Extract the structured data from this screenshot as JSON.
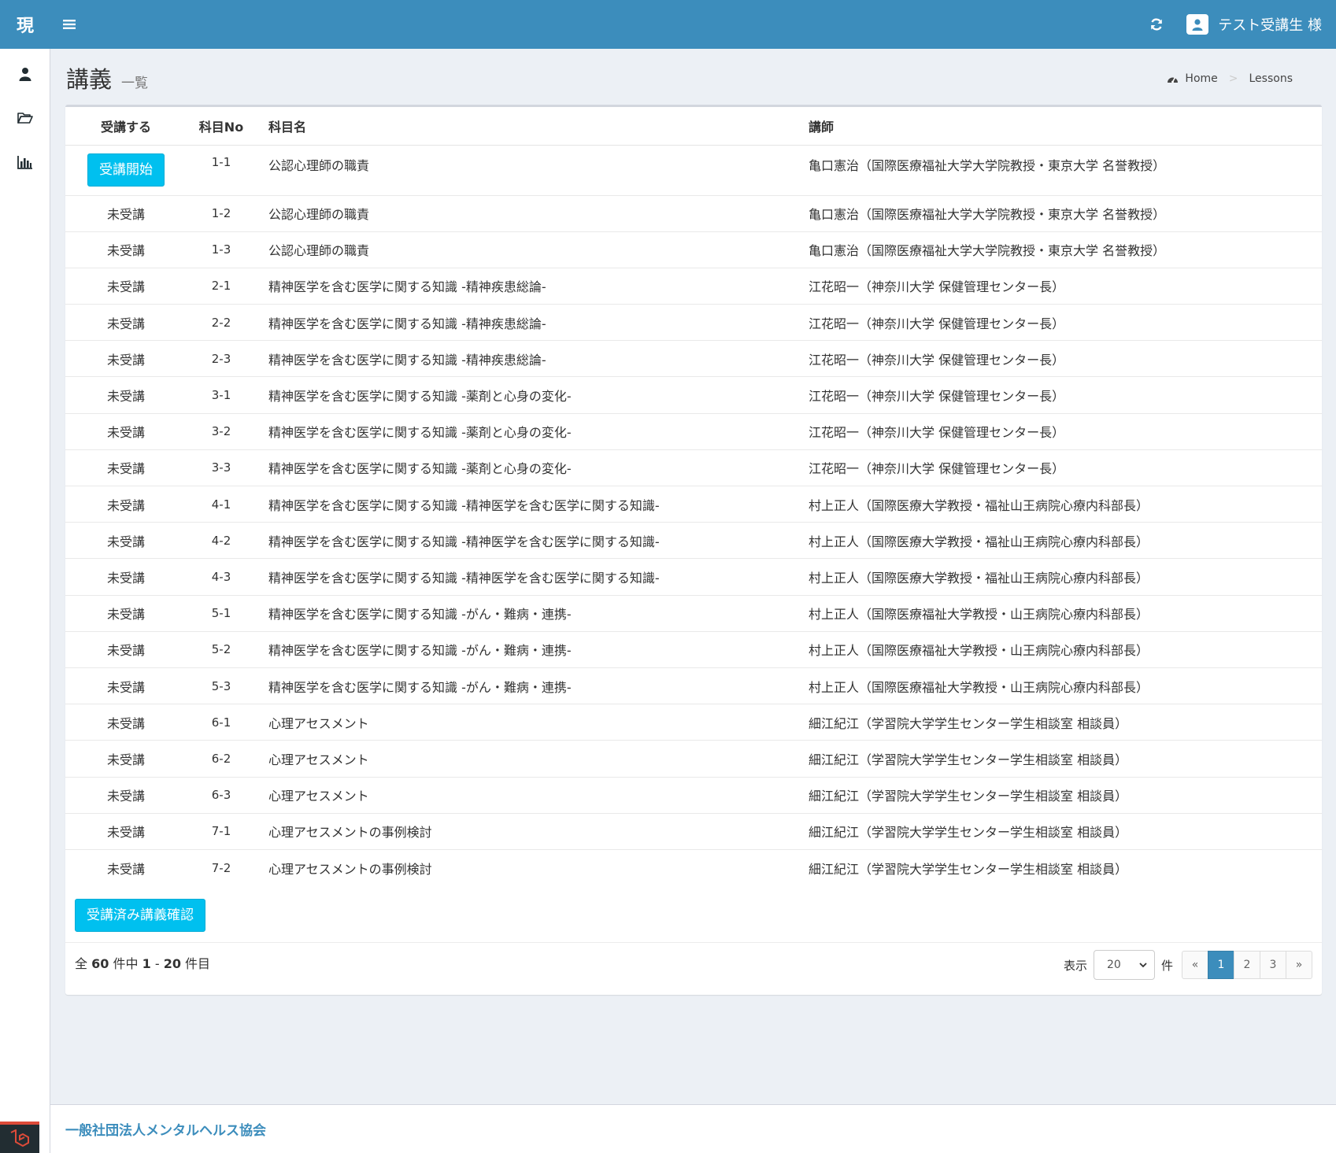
{
  "header": {
    "logo": "現",
    "user_name": "テスト受講生 様"
  },
  "content_header": {
    "title": "講義",
    "subtitle": "一覧",
    "breadcrumb": {
      "home": "Home",
      "current": "Lessons"
    }
  },
  "table": {
    "columns": [
      "受講する",
      "科目No",
      "科目名",
      "講師"
    ],
    "rows": [
      {
        "status": "受講開始",
        "no": "1-1",
        "name": "公認心理師の職責",
        "teacher": "亀口憲治（国際医療福祉大学大学院教授・東京大学 名誉教授）"
      },
      {
        "status": "未受講",
        "no": "1-2",
        "name": "公認心理師の職責",
        "teacher": "亀口憲治（国際医療福祉大学大学院教授・東京大学 名誉教授）"
      },
      {
        "status": "未受講",
        "no": "1-3",
        "name": "公認心理師の職責",
        "teacher": "亀口憲治（国際医療福祉大学大学院教授・東京大学 名誉教授）"
      },
      {
        "status": "未受講",
        "no": "2-1",
        "name": "精神医学を含む医学に関する知識 -精神疾患総論-",
        "teacher": "江花昭一（神奈川大学 保健管理センター長）"
      },
      {
        "status": "未受講",
        "no": "2-2",
        "name": "精神医学を含む医学に関する知識 -精神疾患総論-",
        "teacher": "江花昭一（神奈川大学 保健管理センター長）"
      },
      {
        "status": "未受講",
        "no": "2-3",
        "name": "精神医学を含む医学に関する知識 -精神疾患総論-",
        "teacher": "江花昭一（神奈川大学 保健管理センター長）"
      },
      {
        "status": "未受講",
        "no": "3-1",
        "name": "精神医学を含む医学に関する知識 -薬剤と心身の変化-",
        "teacher": "江花昭一（神奈川大学 保健管理センター長）"
      },
      {
        "status": "未受講",
        "no": "3-2",
        "name": "精神医学を含む医学に関する知識 -薬剤と心身の変化-",
        "teacher": "江花昭一（神奈川大学 保健管理センター長）"
      },
      {
        "status": "未受講",
        "no": "3-3",
        "name": "精神医学を含む医学に関する知識 -薬剤と心身の変化-",
        "teacher": "江花昭一（神奈川大学 保健管理センター長）"
      },
      {
        "status": "未受講",
        "no": "4-1",
        "name": "精神医学を含む医学に関する知識 -精神医学を含む医学に関する知識-",
        "teacher": "村上正人（国際医療大学教授・福祉山王病院心療内科部長）"
      },
      {
        "status": "未受講",
        "no": "4-2",
        "name": "精神医学を含む医学に関する知識 -精神医学を含む医学に関する知識-",
        "teacher": "村上正人（国際医療大学教授・福祉山王病院心療内科部長）"
      },
      {
        "status": "未受講",
        "no": "4-3",
        "name": "精神医学を含む医学に関する知識 -精神医学を含む医学に関する知識-",
        "teacher": "村上正人（国際医療大学教授・福祉山王病院心療内科部長）"
      },
      {
        "status": "未受講",
        "no": "5-1",
        "name": "精神医学を含む医学に関する知識 -がん・難病・連携-",
        "teacher": "村上正人（国際医療福祉大学教授・山王病院心療内科部長）"
      },
      {
        "status": "未受講",
        "no": "5-2",
        "name": "精神医学を含む医学に関する知識 -がん・難病・連携-",
        "teacher": "村上正人（国際医療福祉大学教授・山王病院心療内科部長）"
      },
      {
        "status": "未受講",
        "no": "5-3",
        "name": "精神医学を含む医学に関する知識 -がん・難病・連携-",
        "teacher": "村上正人（国際医療福祉大学教授・山王病院心療内科部長）"
      },
      {
        "status": "未受講",
        "no": "6-1",
        "name": "心理アセスメント",
        "teacher": "細江紀江（学習院大学学生センター学生相談室 相談員）"
      },
      {
        "status": "未受講",
        "no": "6-2",
        "name": "心理アセスメント",
        "teacher": "細江紀江（学習院大学学生センター学生相談室 相談員）"
      },
      {
        "status": "未受講",
        "no": "6-3",
        "name": "心理アセスメント",
        "teacher": "細江紀江（学習院大学学生センター学生相談室 相談員）"
      },
      {
        "status": "未受講",
        "no": "7-1",
        "name": "心理アセスメントの事例検討",
        "teacher": "細江紀江（学習院大学学生センター学生相談室 相談員）"
      },
      {
        "status": "未受講",
        "no": "7-2",
        "name": "心理アセスメントの事例検討",
        "teacher": "細江紀江（学習院大学学生センター学生相談室 相談員）"
      }
    ]
  },
  "actions": {
    "completed_button": "受講済み講義確認"
  },
  "summary": {
    "prefix": "全",
    "total": "60",
    "mid": "件中",
    "from": "1",
    "dash": "-",
    "to": "20",
    "suffix": "件目"
  },
  "pager": {
    "display_label": "表示",
    "per_page": "20",
    "unit_label": "件",
    "prev": "«",
    "pages": [
      "1",
      "2",
      "3"
    ],
    "active_page": "1",
    "next": "»"
  },
  "footer": {
    "org_name": "一般社団法人メンタルヘルス協会"
  },
  "colors": {
    "header_bg": "#3c8dbc",
    "info_button": "#00c0ef",
    "active_page": "#3c8dbc",
    "footer_link": "#3c8dbc"
  },
  "icons": {
    "sidebar": [
      "user-icon",
      "folder-open-icon",
      "bar-chart-icon"
    ],
    "topbar": [
      "hamburger-icon",
      "refresh-icon",
      "user-avatar-icon"
    ],
    "breadcrumb": "dashboard-icon",
    "footer_corner": "laravel-icon"
  }
}
